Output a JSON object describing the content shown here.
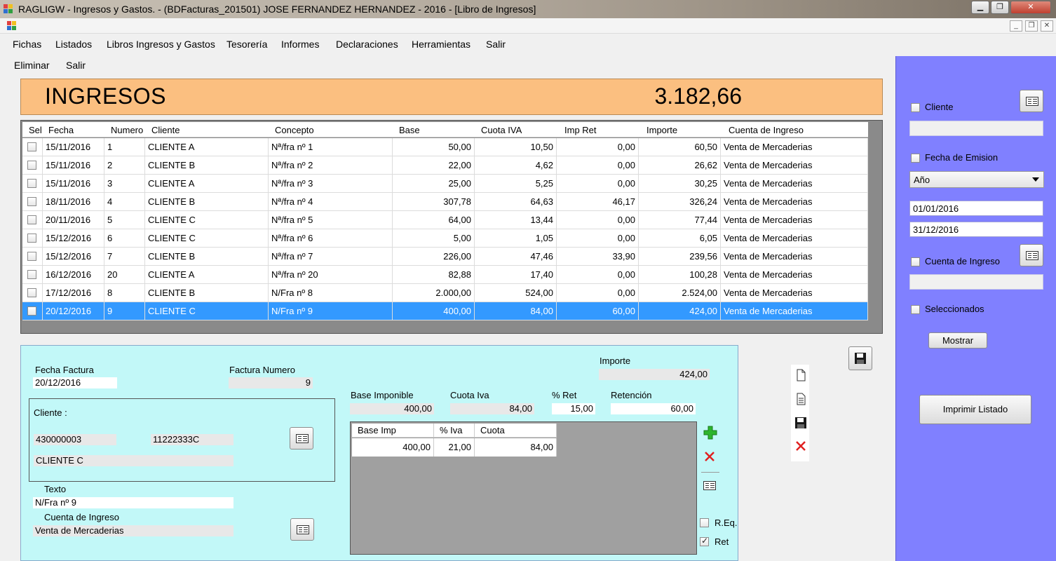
{
  "window": {
    "title": "RAGLIGW - Ingresos y Gastos. - (BDFacturas_201501)   JOSE FERNANDEZ HERNANDEZ - 2016 - [Libro de Ingresos]",
    "minimize": "▁",
    "restore": "❐",
    "close": "✕"
  },
  "mdi": {
    "minimize": "_",
    "restore": "❐",
    "close": "✕"
  },
  "menu": [
    "Fichas",
    "Listados",
    "Libros Ingresos y Gastos",
    "Tesorería",
    "Informes",
    "Declaraciones",
    "Herramientas",
    "Salir"
  ],
  "submenu": [
    "Eliminar",
    "Salir"
  ],
  "banner": {
    "label": "INGRESOS",
    "total": "3.182,66",
    "color": "#fbbf80"
  },
  "grid": {
    "columns": [
      "Sel",
      "Fecha",
      "Numero",
      "Cliente",
      "Concepto",
      "Base",
      "Cuota IVA",
      "Imp Ret",
      "Importe",
      "Cuenta de Ingreso"
    ],
    "rows": [
      {
        "fecha": "15/11/2016",
        "numero": "1",
        "cliente": "CLIENTE A",
        "concepto": "Nª/fra nº 1",
        "base": "50,00",
        "cuota": "10,50",
        "ret": "0,00",
        "importe": "60,50",
        "cuenta": "Venta de Mercaderias"
      },
      {
        "fecha": "15/11/2016",
        "numero": "2",
        "cliente": "CLIENTE B",
        "concepto": "Nª/fra nº 2",
        "base": "22,00",
        "cuota": "4,62",
        "ret": "0,00",
        "importe": "26,62",
        "cuenta": "Venta de Mercaderias"
      },
      {
        "fecha": "15/11/2016",
        "numero": "3",
        "cliente": "CLIENTE A",
        "concepto": "Nª/fra nº 3",
        "base": "25,00",
        "cuota": "5,25",
        "ret": "0,00",
        "importe": "30,25",
        "cuenta": "Venta de Mercaderias"
      },
      {
        "fecha": "18/11/2016",
        "numero": "4",
        "cliente": "CLIENTE B",
        "concepto": "Nª/fra nº 4",
        "base": "307,78",
        "cuota": "64,63",
        "ret": "46,17",
        "importe": "326,24",
        "cuenta": "Venta de Mercaderias"
      },
      {
        "fecha": "20/11/2016",
        "numero": "5",
        "cliente": "CLIENTE C",
        "concepto": "Nª/fra nº 5",
        "base": "64,00",
        "cuota": "13,44",
        "ret": "0,00",
        "importe": "77,44",
        "cuenta": "Venta de Mercaderias"
      },
      {
        "fecha": "15/12/2016",
        "numero": "6",
        "cliente": "CLIENTE C",
        "concepto": "Nª/fra nº 6",
        "base": "5,00",
        "cuota": "1,05",
        "ret": "0,00",
        "importe": "6,05",
        "cuenta": "Venta de Mercaderias"
      },
      {
        "fecha": "15/12/2016",
        "numero": "7",
        "cliente": "CLIENTE B",
        "concepto": "Nª/fra nº 7",
        "base": "226,00",
        "cuota": "47,46",
        "ret": "33,90",
        "importe": "239,56",
        "cuenta": "Venta de Mercaderias"
      },
      {
        "fecha": "16/12/2016",
        "numero": "20",
        "cliente": "CLIENTE A",
        "concepto": "Nª/fra nº 20",
        "base": "82,88",
        "cuota": "17,40",
        "ret": "0,00",
        "importe": "100,28",
        "cuenta": "Venta de Mercaderias"
      },
      {
        "fecha": "17/12/2016",
        "numero": "8",
        "cliente": "CLIENTE B",
        "concepto": "N/Fra nº 8",
        "base": "2.000,00",
        "cuota": "524,00",
        "ret": "0,00",
        "importe": "2.524,00",
        "cuenta": "Venta de Mercaderias"
      },
      {
        "fecha": "20/12/2016",
        "numero": "9",
        "cliente": "CLIENTE C",
        "concepto": "N/Fra nº 9",
        "base": "400,00",
        "cuota": "84,00",
        "ret": "60,00",
        "importe": "424,00",
        "cuenta": "Venta de Mercaderias",
        "selected": true
      }
    ],
    "selected_color": "#3399ff"
  },
  "filters": {
    "cliente_label": "Cliente",
    "fecha_label": "Fecha de Emision",
    "periodo": "Año",
    "desde": "01/01/2016",
    "hasta": "31/12/2016",
    "cuenta_label": "Cuenta de Ingreso",
    "seleccionados_label": "Seleccionados",
    "mostrar": "Mostrar",
    "imprimir": "Imprimir Listado",
    "panel_color": "#8080ff"
  },
  "detail": {
    "fecha_label": "Fecha Factura",
    "fecha": "20/12/2016",
    "numero_label": "Factura Numero",
    "numero": "9",
    "importe_label": "Importe",
    "importe": "424,00",
    "cliente_label": "Cliente :",
    "cliente_cuenta": "430000003",
    "cliente_nif": "11222333C",
    "cliente_nombre": "CLIENTE C",
    "texto_label": "Texto",
    "texto": "N/Fra nº 9",
    "cuenta_label": "Cuenta de Ingreso",
    "cuenta": "Venta de Mercaderias",
    "base_label": "Base Imponible",
    "base": "400,00",
    "cuota_label": "Cuota Iva",
    "cuota": "84,00",
    "pret_label": "% Ret",
    "pret": "15,00",
    "retencion_label": "Retención",
    "retencion": "60,00",
    "iva_grid": {
      "columns": [
        "Base Imp",
        "% Iva",
        "Cuota"
      ],
      "row": [
        "400,00",
        "21,00",
        "84,00"
      ]
    },
    "req_label": "R.Eq.",
    "ret_label": "Ret",
    "panel_color": "#c2f8f8"
  }
}
